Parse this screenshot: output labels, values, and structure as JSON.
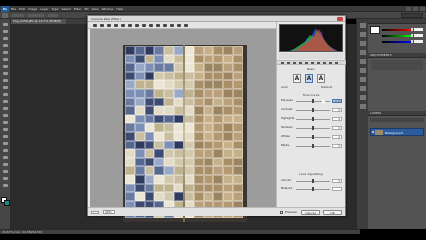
{
  "app": {
    "logo": "Ps",
    "menu": [
      "File",
      "Edit",
      "Image",
      "Layer",
      "Type",
      "Select",
      "Filter",
      "3D",
      "View",
      "Window",
      "Help"
    ],
    "workspace": "Essentials"
  },
  "document": {
    "tab_title": "Img_0156.JPG @ 16.7% (RGB/8)",
    "status_text": "16.67%  Doc: 24.5M/24.5M"
  },
  "panels": {
    "adjust_header": "Adjustments",
    "layers_header": "Layers",
    "layer_name": "Background"
  },
  "camera_raw": {
    "title": "Camera Raw (Filter)",
    "zoom": "16%",
    "section_title": "Basic",
    "wb_section": "Auto",
    "wb_icons": [
      "A",
      "A",
      "A"
    ],
    "labels_small": [
      "Auto",
      "Default"
    ],
    "tone_section": "Tone Curve",
    "presence_section": "Lens Vignetting",
    "sliders": [
      {
        "label": "Exposure",
        "value": "+0.00",
        "pos": 0.5,
        "highlight": true
      },
      {
        "label": "Contrast",
        "value": "0",
        "pos": 0.5
      },
      {
        "label": "Highlights",
        "value": "0",
        "pos": 0.5
      },
      {
        "label": "Shadows",
        "value": "0",
        "pos": 0.5
      },
      {
        "label": "Whites",
        "value": "0",
        "pos": 0.5
      },
      {
        "label": "Blacks",
        "value": "0",
        "pos": 0.5
      }
    ],
    "presence_sliders": [
      {
        "label": "Amount",
        "value": "0",
        "pos": 0.5
      },
      {
        "label": "Midpoint",
        "value": "",
        "pos": 0.5
      }
    ],
    "cancel": "Cancel",
    "ok": "OK",
    "preview_label": "Preview"
  },
  "colors": {
    "photo_blue": "#4b5a82",
    "photo_cream": "#d8d0b6",
    "photo_tan": "#b49a72",
    "accent": "#4a72b0"
  }
}
